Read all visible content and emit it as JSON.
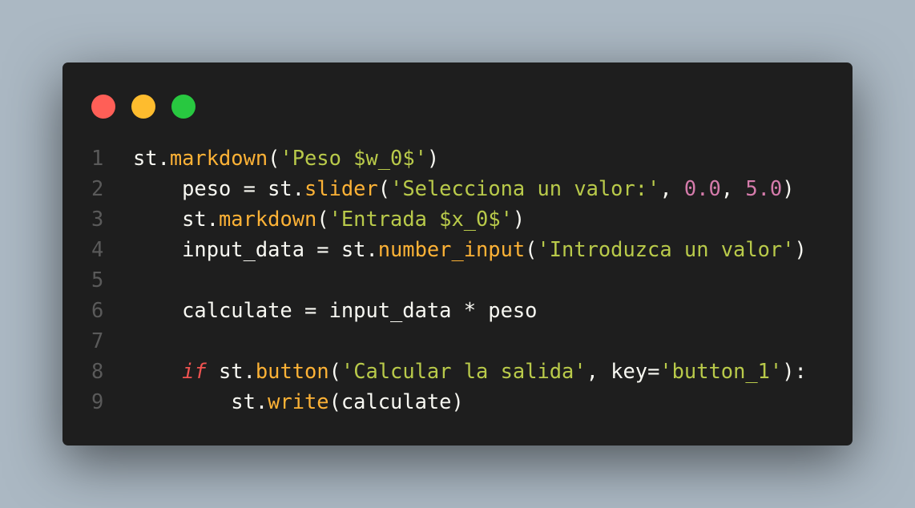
{
  "window": {
    "controls": [
      {
        "name": "close",
        "color": "#ff5f57"
      },
      {
        "name": "minimize",
        "color": "#febc2e"
      },
      {
        "name": "maximize",
        "color": "#28c840"
      }
    ]
  },
  "colors": {
    "background": "#abb8c3",
    "editor_bg": "#1e1e1e",
    "function": "#fdb236",
    "string": "#b9ca4a",
    "number": "#d57bab",
    "keyword": "#ef5350",
    "text": "#f8f8f2",
    "line_number": "#5a5a5a"
  },
  "code": {
    "lines": [
      {
        "number": "1",
        "tokens": [
          {
            "t": "st.",
            "c": ""
          },
          {
            "t": "markdown",
            "c": "fn"
          },
          {
            "t": "(",
            "c": ""
          },
          {
            "t": "'Peso $w_0$'",
            "c": "str"
          },
          {
            "t": ")",
            "c": ""
          }
        ]
      },
      {
        "number": "2",
        "tokens": [
          {
            "t": "    peso = st.",
            "c": ""
          },
          {
            "t": "slider",
            "c": "fn"
          },
          {
            "t": "(",
            "c": ""
          },
          {
            "t": "'Selecciona un valor:'",
            "c": "str"
          },
          {
            "t": ", ",
            "c": ""
          },
          {
            "t": "0.0",
            "c": "num"
          },
          {
            "t": ", ",
            "c": ""
          },
          {
            "t": "5.0",
            "c": "num"
          },
          {
            "t": ")",
            "c": ""
          }
        ]
      },
      {
        "number": "3",
        "tokens": [
          {
            "t": "    st.",
            "c": ""
          },
          {
            "t": "markdown",
            "c": "fn"
          },
          {
            "t": "(",
            "c": ""
          },
          {
            "t": "'Entrada $x_0$'",
            "c": "str"
          },
          {
            "t": ")",
            "c": ""
          }
        ]
      },
      {
        "number": "4",
        "tokens": [
          {
            "t": "    input_data = st.",
            "c": ""
          },
          {
            "t": "number_input",
            "c": "fn"
          },
          {
            "t": "(",
            "c": ""
          },
          {
            "t": "'Introduzca un valor'",
            "c": "str"
          },
          {
            "t": ")",
            "c": ""
          }
        ]
      },
      {
        "number": "5",
        "tokens": []
      },
      {
        "number": "6",
        "tokens": [
          {
            "t": "    calculate = input_data * peso",
            "c": ""
          }
        ]
      },
      {
        "number": "7",
        "tokens": []
      },
      {
        "number": "8",
        "tokens": [
          {
            "t": "    ",
            "c": ""
          },
          {
            "t": "if",
            "c": "kw"
          },
          {
            "t": " st.",
            "c": ""
          },
          {
            "t": "button",
            "c": "fn"
          },
          {
            "t": "(",
            "c": ""
          },
          {
            "t": "'Calcular la salida'",
            "c": "str"
          },
          {
            "t": ", key=",
            "c": ""
          },
          {
            "t": "'button_1'",
            "c": "str"
          },
          {
            "t": "):",
            "c": ""
          }
        ]
      },
      {
        "number": "9",
        "tokens": [
          {
            "t": "        st.",
            "c": ""
          },
          {
            "t": "write",
            "c": "fn"
          },
          {
            "t": "(calculate)",
            "c": ""
          }
        ]
      }
    ]
  }
}
